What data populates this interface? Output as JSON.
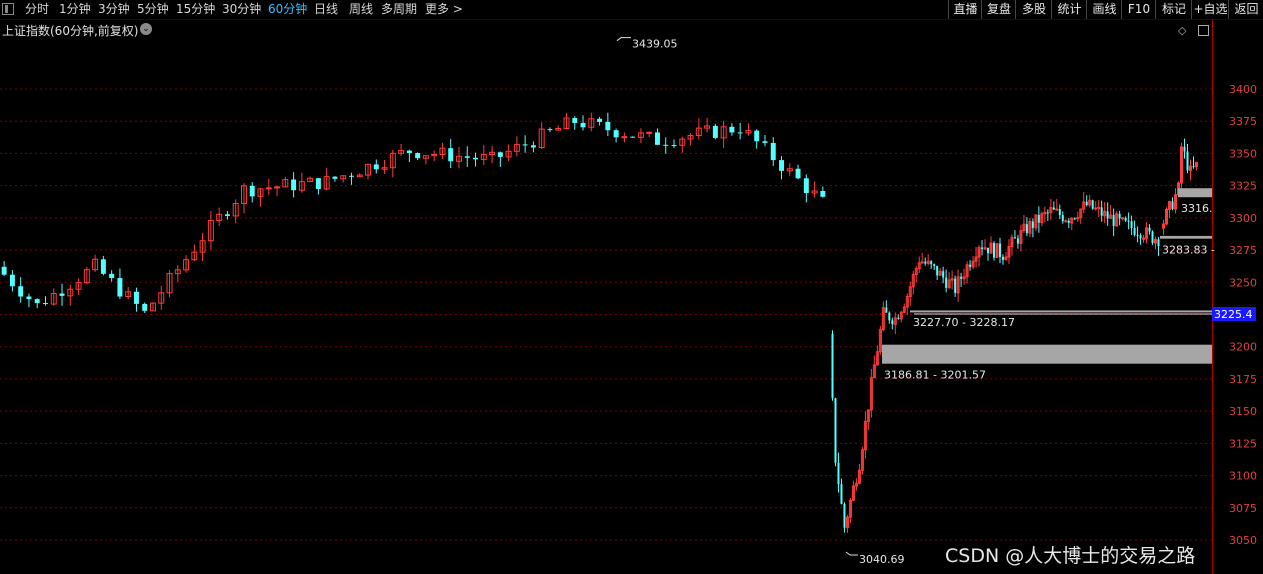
{
  "toolbar": {
    "periods": [
      "分时",
      "1分钟",
      "3分钟",
      "5分钟",
      "15分钟",
      "30分钟",
      "60分钟",
      "日线",
      "周线",
      "多周期",
      "更多 >"
    ],
    "active_period": "60分钟",
    "right_buttons": [
      "直播",
      "复盘",
      "多股",
      "统计",
      "画线",
      "F10",
      "标记",
      "+自选",
      "返回"
    ]
  },
  "title": "上证指数(60分钟,前复权)",
  "current_price_label": "3225.4",
  "watermark": "CSDN @人大博士的交易之路",
  "colors": {
    "up": "#ff3b3b",
    "down": "#54ffff",
    "grid": "#7a0000",
    "axis_text": "#e04040",
    "price_tag": "#1a1aff",
    "zone": "#a6a6a6"
  },
  "chart_data": {
    "type": "candlestick",
    "ylim": [
      3040,
      3445
    ],
    "yticks": [
      3050,
      3075,
      3100,
      3125,
      3150,
      3175,
      3200,
      3225,
      3250,
      3275,
      3300,
      3325,
      3350,
      3375,
      3400
    ],
    "grid": true,
    "annotations": [
      {
        "text": "3439.05",
        "kind": "high",
        "value": 3439.05
      },
      {
        "text": "3040.69",
        "kind": "low",
        "value": 3040.69
      },
      {
        "text": "3227.70 - 3228.17",
        "kind": "gap-zone",
        "low": 3227.7,
        "high": 3228.17
      },
      {
        "text": "3186.81 - 3201.57",
        "kind": "gap-zone",
        "low": 3186.81,
        "high": 3201.57
      },
      {
        "text": "3283.83 -",
        "kind": "gap-zone",
        "low": 3283.83,
        "high": 3286.0
      },
      {
        "text": "3316.",
        "kind": "gap-zone",
        "low": 3316.0,
        "high": 3323.0
      }
    ],
    "segments": [
      {
        "bars": 100,
        "start": 3262,
        "waypoints": [
          [
            0,
            3262
          ],
          [
            5,
            3232
          ],
          [
            12,
            3262
          ],
          [
            18,
            3226
          ],
          [
            25,
            3285
          ],
          [
            30,
            3322
          ],
          [
            40,
            3328
          ],
          [
            50,
            3352
          ],
          [
            60,
            3345
          ],
          [
            70,
            3375
          ],
          [
            80,
            3360
          ],
          [
            90,
            3370
          ],
          [
            100,
            3312
          ],
          [
            108,
            3335
          ],
          [
            115,
            3375
          ],
          [
            125,
            3348
          ],
          [
            130,
            3378
          ],
          [
            137,
            3352
          ],
          [
            140,
            3412
          ],
          [
            145,
            3430
          ],
          [
            155,
            3439
          ],
          [
            160,
            3412
          ],
          [
            165,
            3368
          ],
          [
            175,
            3378
          ],
          [
            180,
            3380
          ],
          [
            188,
            3342
          ],
          [
            195,
            3326
          ],
          [
            200,
            3348
          ],
          [
            204,
            3342
          ]
        ]
      },
      {
        "bars": 110,
        "start": 3210,
        "waypoints": [
          [
            0,
            3210
          ],
          [
            2,
            3110
          ],
          [
            5,
            3060
          ],
          [
            10,
            3110
          ],
          [
            15,
            3185
          ],
          [
            18,
            3225
          ],
          [
            22,
            3222
          ],
          [
            26,
            3240
          ],
          [
            30,
            3268
          ],
          [
            36,
            3258
          ],
          [
            42,
            3245
          ],
          [
            50,
            3280
          ],
          [
            58,
            3272
          ],
          [
            66,
            3292
          ],
          [
            74,
            3305
          ],
          [
            80,
            3300
          ],
          [
            86,
            3310
          ],
          [
            92,
            3302
          ],
          [
            98,
            3295
          ],
          [
            104,
            3290
          ],
          [
            108,
            3285
          ],
          [
            110,
            3284
          ]
        ]
      },
      {
        "bars": 12,
        "start": 3292,
        "waypoints": [
          [
            0,
            3292
          ],
          [
            4,
            3312
          ],
          [
            6,
            3322
          ],
          [
            7,
            3355
          ],
          [
            10,
            3335
          ],
          [
            12,
            3340
          ]
        ]
      }
    ],
    "current_price": 3225.4
  }
}
